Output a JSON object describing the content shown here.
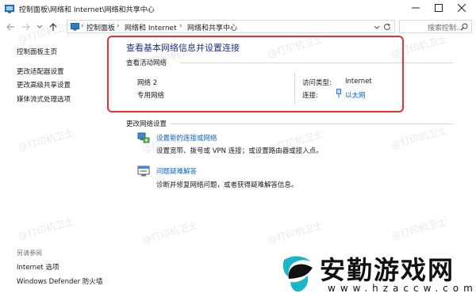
{
  "window": {
    "title": "控制面板\\网络和 Internet\\网络和共享中心"
  },
  "nav": {
    "breadcrumbs": [
      "控制面板",
      "网络和 Internet",
      "网络和共享中心"
    ],
    "search_placeholder": "搜索控制..."
  },
  "sidebar": {
    "items": [
      "控制面板主页",
      "更改适配器设置",
      "更改高级共享设置",
      "媒体流式处理选项"
    ],
    "see_also_heading": "另请参阅",
    "see_also": [
      "Internet 选项",
      "Windows Defender 防火墙"
    ]
  },
  "main": {
    "title": "查看基本网络信息并设置连接",
    "active_networks_label": "查看活动网络",
    "network": {
      "name": "网络 2",
      "type": "专用网络",
      "access_type_label": "访问类型:",
      "access_type_value": "Internet",
      "connections_label": "连接:",
      "connections_value": "以太网"
    },
    "change_settings_label": "更改网络设置",
    "actions": [
      {
        "title": "设置新的连接或网络",
        "description": "设置宽带、拨号或 VPN 连接；或设置路由器或接入点。",
        "icon": "network-setup-icon"
      },
      {
        "title": "问题疑难解答",
        "description": "诊断并修复网络问题，或者获得疑难解答信息。",
        "icon": "troubleshoot-icon"
      }
    ]
  },
  "watermark_text": "@打印机卫士",
  "logo": {
    "text": "安勤游戏网",
    "url": "www.hzaccw.com"
  },
  "colors": {
    "title_blue": "#1e3287",
    "link_blue": "#0a66c0",
    "highlight_red": "#e8302c"
  }
}
